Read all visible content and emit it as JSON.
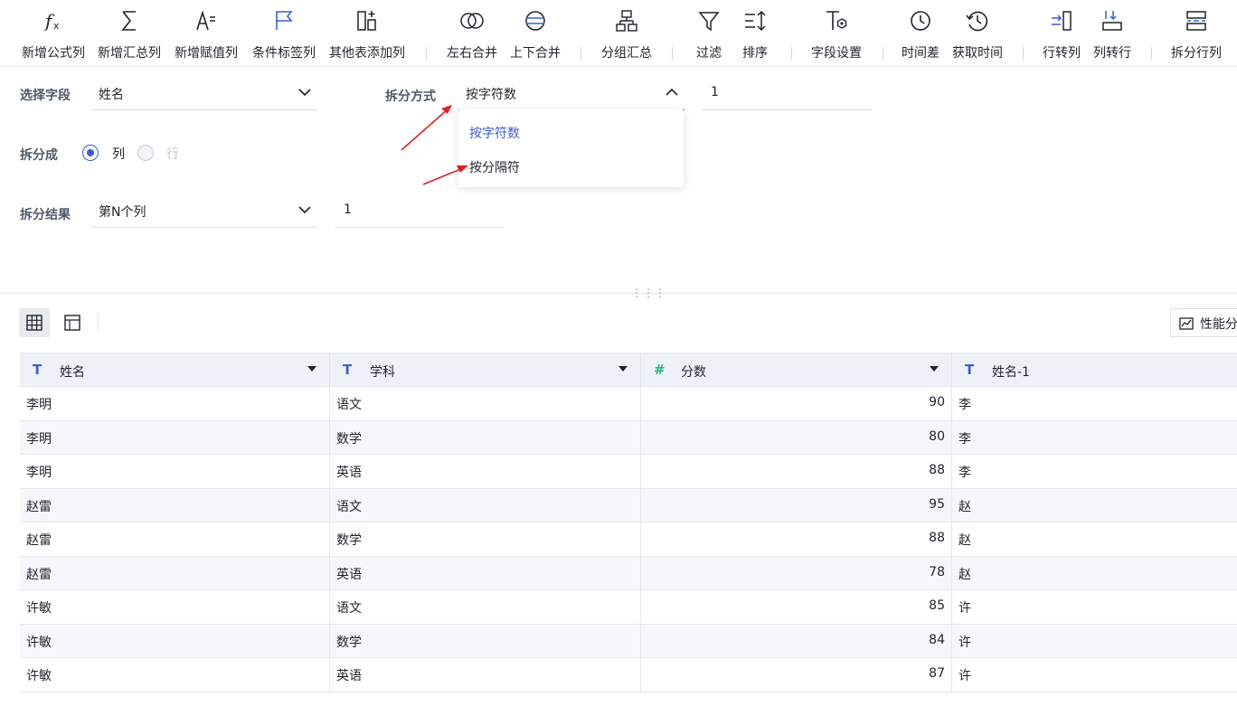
{
  "toolbar": {
    "items": [
      {
        "label": "新增公式列",
        "icon": "fx-icon"
      },
      {
        "label": "新增汇总列",
        "icon": "sigma-icon"
      },
      {
        "label": "新增赋值列",
        "icon": "assign-value-icon"
      },
      {
        "label": "条件标签列",
        "icon": "flag-icon"
      },
      {
        "label": "其他表添加列",
        "icon": "add-column-icon"
      },
      {
        "label": "左右合并",
        "icon": "merge-horizontal-icon"
      },
      {
        "label": "上下合并",
        "icon": "merge-vertical-icon"
      },
      {
        "label": "分组汇总",
        "icon": "group-summary-icon"
      },
      {
        "label": "过滤",
        "icon": "filter-icon"
      },
      {
        "label": "排序",
        "icon": "sort-icon"
      },
      {
        "label": "字段设置",
        "icon": "field-settings-icon"
      },
      {
        "label": "时间差",
        "icon": "clock-icon"
      },
      {
        "label": "获取时间",
        "icon": "clock-refresh-icon"
      },
      {
        "label": "行转列",
        "icon": "row-to-column-icon"
      },
      {
        "label": "列转行",
        "icon": "column-to-row-icon"
      },
      {
        "label": "拆分行列",
        "icon": "split-rows-columns-icon"
      }
    ]
  },
  "config": {
    "select_field_label": "选择字段",
    "select_field_value": "姓名",
    "split_method_label": "拆分方式",
    "split_method_value": "按字符数",
    "split_method_count": "1",
    "split_into_label": "拆分成",
    "split_into_options": {
      "column": "列",
      "row": "行"
    },
    "split_into_selected": "列",
    "split_result_label": "拆分结果",
    "split_result_value": "第N个列",
    "split_result_n": "1",
    "dropdown_options": [
      "按字符数",
      "按分隔符"
    ]
  },
  "view": {
    "perf_label": "性能分"
  },
  "table": {
    "columns": [
      {
        "name": "姓名",
        "type": "text"
      },
      {
        "name": "学科",
        "type": "text"
      },
      {
        "name": "分数",
        "type": "number"
      },
      {
        "name": "姓名-1",
        "type": "text"
      }
    ],
    "rows": [
      [
        "李明",
        "语文",
        "90",
        "李"
      ],
      [
        "李明",
        "数学",
        "80",
        "李"
      ],
      [
        "李明",
        "英语",
        "88",
        "李"
      ],
      [
        "赵雷",
        "语文",
        "95",
        "赵"
      ],
      [
        "赵雷",
        "数学",
        "88",
        "赵"
      ],
      [
        "赵雷",
        "英语",
        "78",
        "赵"
      ],
      [
        "许敏",
        "语文",
        "85",
        "许"
      ],
      [
        "许敏",
        "数学",
        "84",
        "许"
      ],
      [
        "许敏",
        "英语",
        "87",
        "许"
      ]
    ]
  },
  "colors": {
    "accent": "#3a5fcd",
    "annotation_arrow": "#e02020",
    "text_type_icon": "#3a5fcd",
    "number_type_icon": "#2bb57a"
  }
}
